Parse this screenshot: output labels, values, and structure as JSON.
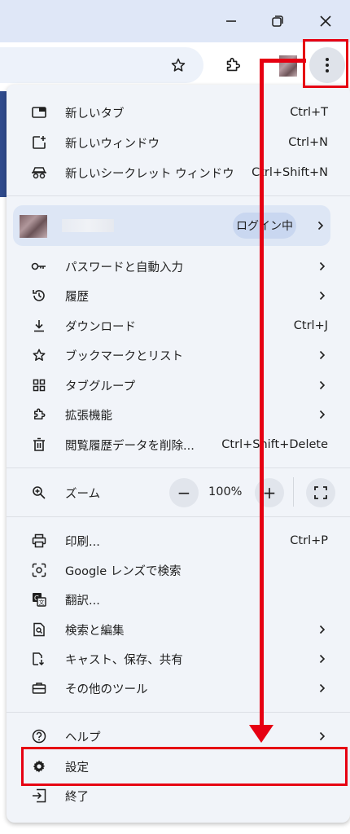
{
  "window": {
    "minimize": "minimize",
    "restore": "restore",
    "close": "close"
  },
  "toolbar": {
    "bookmark_icon": "star-icon",
    "extensions_icon": "puzzle-icon",
    "menu_icon": "kebab-icon"
  },
  "menu": {
    "group1": [
      {
        "label": "新しいタブ",
        "shortcut": "Ctrl+T",
        "icon": "new-tab-icon"
      },
      {
        "label": "新しいウィンドウ",
        "shortcut": "Ctrl+N",
        "icon": "new-window-icon"
      },
      {
        "label": "新しいシークレット ウィンドウ",
        "shortcut": "Ctrl+Shift+N",
        "icon": "incognito-icon"
      }
    ],
    "profile": {
      "status": "ログイン中"
    },
    "group2": [
      {
        "label": "パスワードと自動入力",
        "icon": "key-icon",
        "submenu": true
      },
      {
        "label": "履歴",
        "icon": "history-icon",
        "submenu": true
      },
      {
        "label": "ダウンロード",
        "shortcut": "Ctrl+J",
        "icon": "download-icon"
      },
      {
        "label": "ブックマークとリスト",
        "icon": "star-icon",
        "submenu": true
      },
      {
        "label": "タブグループ",
        "icon": "tab-groups-icon",
        "submenu": true
      },
      {
        "label": "拡張機能",
        "icon": "puzzle-icon",
        "submenu": true
      },
      {
        "label": "閲覧履歴データを削除...",
        "shortcut": "Ctrl+Shift+Delete",
        "icon": "trash-icon"
      }
    ],
    "zoom": {
      "label": "ズーム",
      "minus": "−",
      "value": "100%",
      "plus": "+"
    },
    "group3": [
      {
        "label": "印刷...",
        "shortcut": "Ctrl+P",
        "icon": "print-icon"
      },
      {
        "label": "Google レンズで検索",
        "icon": "lens-icon"
      },
      {
        "label": "翻訳...",
        "icon": "translate-icon"
      },
      {
        "label": "検索と編集",
        "icon": "find-icon",
        "submenu": true
      },
      {
        "label": "キャスト、保存、共有",
        "icon": "cast-icon",
        "submenu": true
      },
      {
        "label": "その他のツール",
        "icon": "toolbox-icon",
        "submenu": true
      }
    ],
    "group4": [
      {
        "label": "ヘルプ",
        "icon": "help-icon",
        "submenu": true
      },
      {
        "label": "設定",
        "icon": "gear-icon"
      },
      {
        "label": "終了",
        "icon": "exit-icon"
      }
    ]
  },
  "colors": {
    "annotation": "#e60012",
    "menu_bg": "#f1f4f9",
    "titlebar_bg": "#dfe7f7"
  }
}
